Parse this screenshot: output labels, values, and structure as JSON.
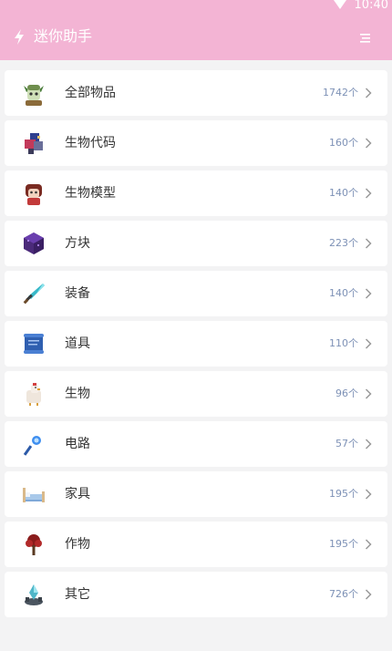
{
  "status": {
    "time": "10:40"
  },
  "header": {
    "title": "迷你助手",
    "bg": "#f3b4d4"
  },
  "items": [
    {
      "label": "全部物品",
      "count": "1742个",
      "icon": "goblin-avatar-icon"
    },
    {
      "label": "生物代码",
      "count": "160个",
      "icon": "mech-creature-icon"
    },
    {
      "label": "生物模型",
      "count": "140个",
      "icon": "character-model-icon"
    },
    {
      "label": "方块",
      "count": "223个",
      "icon": "purple-block-icon"
    },
    {
      "label": "装备",
      "count": "140个",
      "icon": "diamond-sword-icon"
    },
    {
      "label": "道具",
      "count": "110个",
      "icon": "scroll-icon"
    },
    {
      "label": "生物",
      "count": "96个",
      "icon": "chicken-icon"
    },
    {
      "label": "电路",
      "count": "57个",
      "icon": "circuit-wand-icon"
    },
    {
      "label": "家具",
      "count": "195个",
      "icon": "bed-icon"
    },
    {
      "label": "作物",
      "count": "195个",
      "icon": "red-tree-icon"
    },
    {
      "label": "其它",
      "count": "726个",
      "icon": "crystal-icon"
    }
  ]
}
